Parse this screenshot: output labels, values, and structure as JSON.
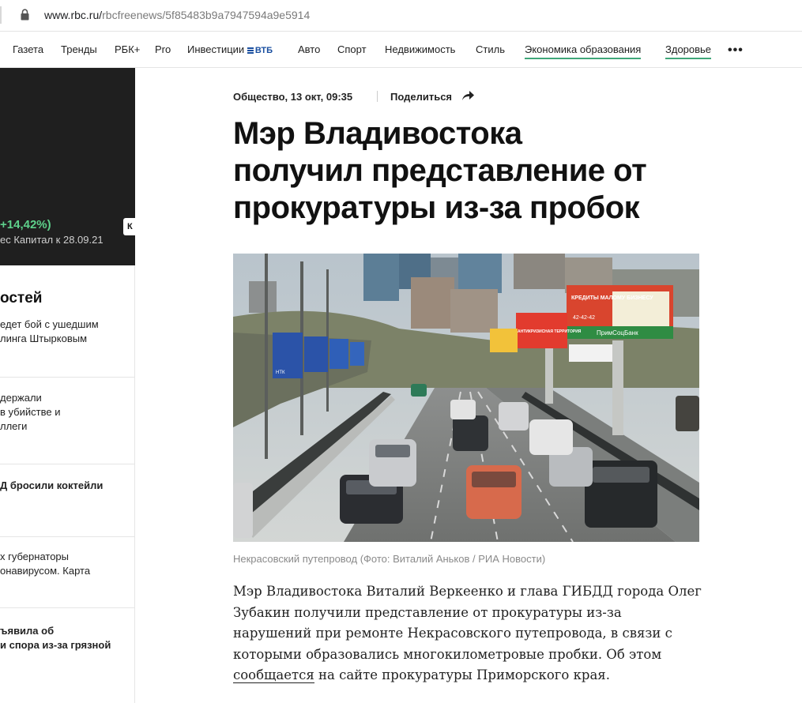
{
  "browser": {
    "url_domain": "www.rbc.ru/",
    "url_path": "rbcfreenews/5f85483b9a7947594a9e5914"
  },
  "nav": {
    "items": [
      "Газета",
      "Тренды",
      "РБК+",
      "Pro",
      "Инвестиции",
      "Авто",
      "Спорт",
      "Недвижимость",
      "Стиль",
      "Экономика образования",
      "Здоровье"
    ],
    "vtb_label": "ВТБ",
    "more": "•••"
  },
  "sidebar": {
    "change_text": "+14,42%)",
    "note_text": "ес Капитал к 28.09.21",
    "key_badge": "К",
    "news_title": "остей",
    "news": [
      {
        "lines": [
          "едет бой с ушедшим",
          "линга Штырковым"
        ]
      },
      {
        "lines": [
          "держали",
          "в убийстве и",
          "ллеги"
        ]
      },
      {
        "lines": [
          "Д бросили коктейли"
        ]
      },
      {
        "lines": [
          "х губернаторы",
          "онавирусом. Карта"
        ]
      },
      {
        "lines": [
          "ъявила об",
          "и спора из-за грязной"
        ]
      }
    ]
  },
  "article": {
    "rubric_date": "Общество, 13 окт, 09:35",
    "share_label": "Поделиться",
    "title_lines": [
      "Мэр Владивостока",
      "получил представление от",
      "прокуратуры из-за пробок"
    ],
    "photo_caption": "Некрасовский путепровод (Фото: Виталий Аньков / РИА Новости)",
    "billboard_texts": [
      "КРЕДИТЫ МАЛОМУ БИЗНЕСУ",
      "42-42-42",
      "ПримСоцБанк",
      "АНТИКРИЗИСНАЯ ТЕРРИТОРИЯ",
      "НТК"
    ],
    "body_lines": [
      "Мэр Владивостока Виталий Веркеенко и глава ГИБДД города Олег",
      "Зубакин получили представление от прокуратуры из-за",
      "нарушений при ремонте Некрасовского путепровода, в связи с",
      "которыми образовались многокилометровые пробки. Об этом"
    ],
    "body_link": "сообщается",
    "body_last_rest": " на сайте прокуратуры Приморского края."
  },
  "colors": {
    "accent_green": "#3fa679",
    "dark_panel": "#1f1f1f",
    "change_green": "#5ed18b",
    "vtb_blue": "#1a4fa0"
  }
}
